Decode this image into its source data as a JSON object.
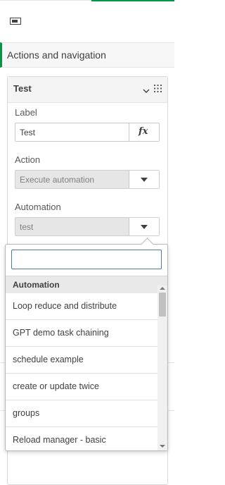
{
  "header": {
    "panel_toggle_icon": "panel-toggle-icon"
  },
  "section": {
    "title": "Actions and navigation",
    "accent_color": "#009845"
  },
  "card": {
    "title": "Test",
    "collapse_icon": "chevron-down-icon",
    "drag_icon": "drag-handle-icon",
    "label": {
      "title": "Label",
      "value": "Test",
      "expression_button": "fx"
    },
    "action": {
      "title": "Action",
      "value": "Execute automation"
    },
    "automation": {
      "title": "Automation",
      "value": "test"
    }
  },
  "dropdown": {
    "search_value": "",
    "group_label": "Automation",
    "items": [
      "Loop reduce and distribute",
      "GPT demo task chaining",
      "schedule example",
      "create or update twice",
      "groups",
      "Reload manager - basic"
    ]
  }
}
